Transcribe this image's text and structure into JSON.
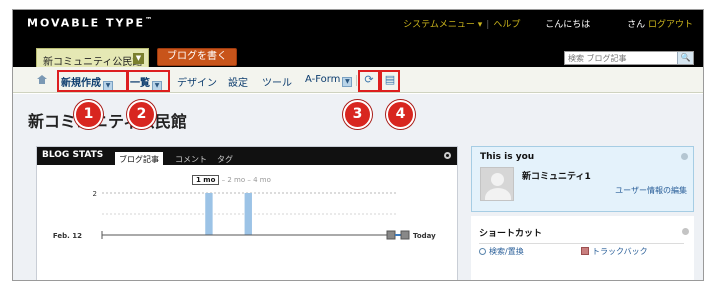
{
  "header": {
    "logo": "MOVABLE TYPE",
    "logo_tm": "™",
    "system_menu": "システムメニュー ▾",
    "help": "ヘルプ",
    "greeting": "こんにちは",
    "san": "さん",
    "logout": "ログアウト",
    "blog_selector": "新コミュニティ公民館",
    "write_button": "ブログを書く",
    "search_placeholder": "検索 ブログ記事"
  },
  "menu": {
    "new": "新規作成",
    "list": "一覧",
    "design": "デザイン",
    "settings": "設定",
    "tools": "ツール",
    "aform": "A-Form"
  },
  "callouts": [
    "1",
    "2",
    "3",
    "4"
  ],
  "page_title": "新コミュニティ公民館",
  "blog_stats": {
    "title": "BLOG STATS",
    "tabs": [
      "ブログ記事",
      "コメント",
      "タグ"
    ],
    "range_selected": "1 mo",
    "range_others": "– 2 mo – 4 mo"
  },
  "chart_data": {
    "type": "bar",
    "x_start_label": "Feb. 12",
    "x_end_label": "Today",
    "y_tick": "2",
    "values": [
      0,
      0,
      0,
      0,
      0,
      0,
      0,
      0,
      0,
      0,
      0,
      0,
      0,
      0,
      0,
      0,
      0,
      0,
      0,
      0,
      0,
      2,
      0,
      0,
      0,
      0,
      0,
      0,
      0,
      2,
      0,
      0,
      0,
      0,
      0,
      0,
      0,
      0,
      0,
      0,
      0,
      0,
      0,
      0,
      0,
      0,
      0,
      0,
      0,
      0,
      0,
      0,
      0,
      0,
      0,
      0,
      0,
      0,
      0,
      0
    ],
    "ylim": [
      0,
      2
    ],
    "grid": true
  },
  "this_is_you": {
    "title": "This is you",
    "name": "新コミュニティ1",
    "edit_link": "ユーザー情報の編集"
  },
  "shortcuts": {
    "title": "ショートカット",
    "items": [
      "検索/置換",
      "トラックバック"
    ]
  },
  "colors": {
    "callout": "#d8261f",
    "write_button": "#c8541a",
    "highlight_box": "#dd1f1f"
  }
}
